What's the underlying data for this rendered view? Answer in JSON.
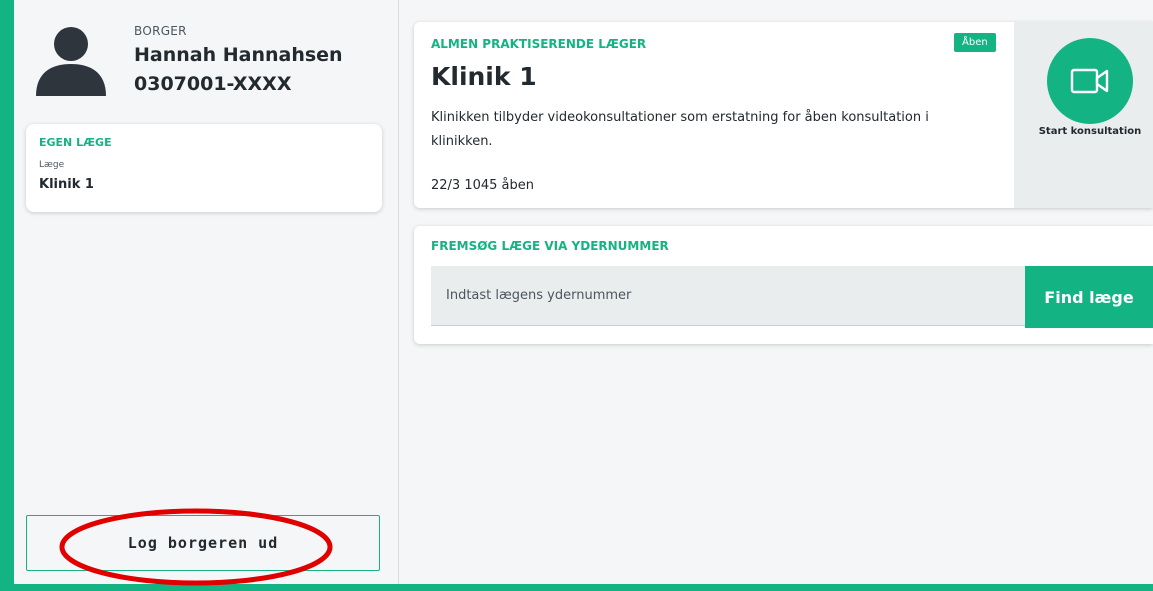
{
  "citizen": {
    "role_label": "BORGER",
    "name": "Hannah Hannahsen",
    "cpr": "0307001-XXXX"
  },
  "own_doctor": {
    "section_title": "EGEN LÆGE",
    "field_label": "Læge",
    "field_value": "Klinik 1"
  },
  "logout": {
    "label": "Log borgeren ud"
  },
  "clinic": {
    "section_title": "ALMEN PRAKTISERENDE LÆGER",
    "status": "Åben",
    "name": "Klinik 1",
    "description": "Klinikken tilbyder videokonsultationer som erstatning for åben konsultation i klinikken.",
    "hours": "22/3 1045 åben",
    "start_label": "Start konsultation",
    "start_icon": "video-camera-icon"
  },
  "search": {
    "section_title": "FREMSØG LÆGE VIA YDERNUMMER",
    "placeholder": "Indtast lægens ydernummer",
    "value": "",
    "button_label": "Find læge"
  },
  "colors": {
    "accent": "#14b384",
    "background": "#f5f6f7",
    "text": "#222a30",
    "panel": "#eaedee",
    "annotation": "#e00000"
  }
}
